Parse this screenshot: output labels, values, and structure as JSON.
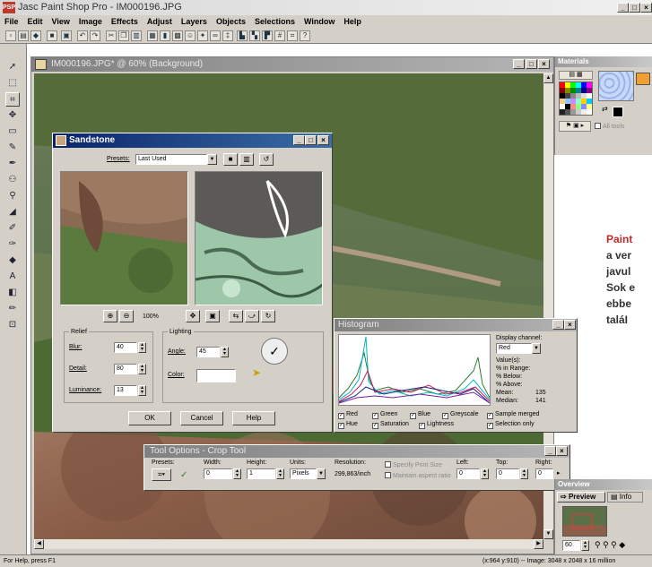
{
  "app": {
    "title": "Jasc Paint Shop Pro - IM000196.JPG",
    "icon_label": "PSP",
    "minimize": "_",
    "maximize": "□",
    "close": "×"
  },
  "menu": [
    "File",
    "Edit",
    "View",
    "Image",
    "Effects",
    "Adjust",
    "Layers",
    "Objects",
    "Selections",
    "Window",
    "Help"
  ],
  "document": {
    "title": "IM000196.JPG* @ 60% (Background)"
  },
  "sandstone": {
    "title": "Sandstone",
    "presets_label": "Presets:",
    "preset_value": "Last Used",
    "zoom": "100%",
    "relief_label": "Relief",
    "blur_label": "Blur:",
    "blur_value": "40",
    "detail_label": "Detail:",
    "detail_value": "80",
    "luminance_label": "Luminance:",
    "luminance_value": "13",
    "lighting_label": "Lighting",
    "angle_label": "Angle:",
    "angle_value": "45",
    "color_label": "Color:",
    "ok": "OK",
    "cancel": "Cancel",
    "help": "Help"
  },
  "histogram": {
    "title": "Histogram",
    "display_channel_label": "Display channel:",
    "display_channel_value": "Red",
    "stats": [
      {
        "label": "Value(s):",
        "value": ""
      },
      {
        "label": "% in Range:",
        "value": ""
      },
      {
        "label": "% Below:",
        "value": ""
      },
      {
        "label": "% Above:",
        "value": ""
      },
      {
        "label": "Mean:",
        "value": "135"
      },
      {
        "label": "Median:",
        "value": "141"
      }
    ],
    "checkboxes_row1": [
      "Red",
      "Green",
      "Blue",
      "Greyscale",
      "Sample merged"
    ],
    "checkboxes_row2": [
      "Hue",
      "Saturation",
      "Lightness",
      "Selection only"
    ]
  },
  "tool_options": {
    "title": "Tool Options - Crop Tool",
    "presets_label": "Presets:",
    "width_label": "Width:",
    "width_value": "0",
    "height_label": "Height:",
    "height_value": "1",
    "units_label": "Units:",
    "units_value": "Pixels",
    "resolution_label": "Resolution:",
    "resolution_value": "299,863/inch",
    "specify_print_size": "Specify Print Size",
    "maintain_aspect": "Maintain aspect ratio",
    "left_label": "Left:",
    "left_value": "0",
    "top_label": "Top:",
    "top_value": "0",
    "right_label": "Right:",
    "right_value": "0"
  },
  "materials": {
    "title": "Materials",
    "all_tools": "All tools"
  },
  "overview": {
    "title": "Overview",
    "tab_preview": "Preview",
    "tab_info": "Info",
    "zoom_value": "60"
  },
  "status": {
    "left": "For Help, press F1",
    "right": "(x:964 y:910) -- Image: 3048 x 2048 x 16 million"
  },
  "article": {
    "line1": "Paint",
    "line2": "a ver",
    "line3": "javul",
    "line4": "Sok e",
    "line5": "ebbe",
    "line6": "taláI"
  },
  "colors": {
    "title_active": "#0a246a",
    "title_inactive": "#808080",
    "article_accent": "#c62828",
    "chrome": "#d4d0c8"
  }
}
